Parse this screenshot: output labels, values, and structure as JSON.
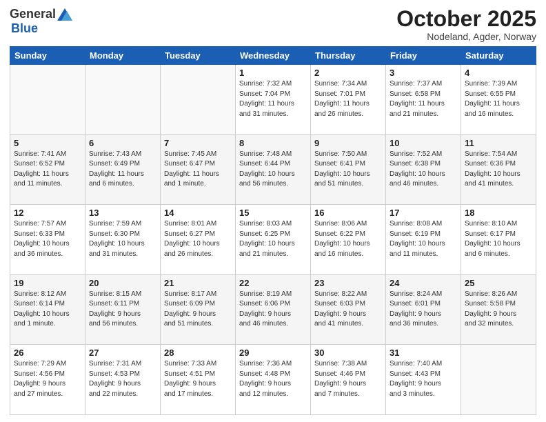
{
  "logo": {
    "general": "General",
    "blue": "Blue"
  },
  "header": {
    "month": "October 2025",
    "location": "Nodeland, Agder, Norway"
  },
  "weekdays": [
    "Sunday",
    "Monday",
    "Tuesday",
    "Wednesday",
    "Thursday",
    "Friday",
    "Saturday"
  ],
  "weeks": [
    [
      {
        "day": "",
        "info": ""
      },
      {
        "day": "",
        "info": ""
      },
      {
        "day": "",
        "info": ""
      },
      {
        "day": "1",
        "info": "Sunrise: 7:32 AM\nSunset: 7:04 PM\nDaylight: 11 hours\nand 31 minutes."
      },
      {
        "day": "2",
        "info": "Sunrise: 7:34 AM\nSunset: 7:01 PM\nDaylight: 11 hours\nand 26 minutes."
      },
      {
        "day": "3",
        "info": "Sunrise: 7:37 AM\nSunset: 6:58 PM\nDaylight: 11 hours\nand 21 minutes."
      },
      {
        "day": "4",
        "info": "Sunrise: 7:39 AM\nSunset: 6:55 PM\nDaylight: 11 hours\nand 16 minutes."
      }
    ],
    [
      {
        "day": "5",
        "info": "Sunrise: 7:41 AM\nSunset: 6:52 PM\nDaylight: 11 hours\nand 11 minutes."
      },
      {
        "day": "6",
        "info": "Sunrise: 7:43 AM\nSunset: 6:49 PM\nDaylight: 11 hours\nand 6 minutes."
      },
      {
        "day": "7",
        "info": "Sunrise: 7:45 AM\nSunset: 6:47 PM\nDaylight: 11 hours\nand 1 minute."
      },
      {
        "day": "8",
        "info": "Sunrise: 7:48 AM\nSunset: 6:44 PM\nDaylight: 10 hours\nand 56 minutes."
      },
      {
        "day": "9",
        "info": "Sunrise: 7:50 AM\nSunset: 6:41 PM\nDaylight: 10 hours\nand 51 minutes."
      },
      {
        "day": "10",
        "info": "Sunrise: 7:52 AM\nSunset: 6:38 PM\nDaylight: 10 hours\nand 46 minutes."
      },
      {
        "day": "11",
        "info": "Sunrise: 7:54 AM\nSunset: 6:36 PM\nDaylight: 10 hours\nand 41 minutes."
      }
    ],
    [
      {
        "day": "12",
        "info": "Sunrise: 7:57 AM\nSunset: 6:33 PM\nDaylight: 10 hours\nand 36 minutes."
      },
      {
        "day": "13",
        "info": "Sunrise: 7:59 AM\nSunset: 6:30 PM\nDaylight: 10 hours\nand 31 minutes."
      },
      {
        "day": "14",
        "info": "Sunrise: 8:01 AM\nSunset: 6:27 PM\nDaylight: 10 hours\nand 26 minutes."
      },
      {
        "day": "15",
        "info": "Sunrise: 8:03 AM\nSunset: 6:25 PM\nDaylight: 10 hours\nand 21 minutes."
      },
      {
        "day": "16",
        "info": "Sunrise: 8:06 AM\nSunset: 6:22 PM\nDaylight: 10 hours\nand 16 minutes."
      },
      {
        "day": "17",
        "info": "Sunrise: 8:08 AM\nSunset: 6:19 PM\nDaylight: 10 hours\nand 11 minutes."
      },
      {
        "day": "18",
        "info": "Sunrise: 8:10 AM\nSunset: 6:17 PM\nDaylight: 10 hours\nand 6 minutes."
      }
    ],
    [
      {
        "day": "19",
        "info": "Sunrise: 8:12 AM\nSunset: 6:14 PM\nDaylight: 10 hours\nand 1 minute."
      },
      {
        "day": "20",
        "info": "Sunrise: 8:15 AM\nSunset: 6:11 PM\nDaylight: 9 hours\nand 56 minutes."
      },
      {
        "day": "21",
        "info": "Sunrise: 8:17 AM\nSunset: 6:09 PM\nDaylight: 9 hours\nand 51 minutes."
      },
      {
        "day": "22",
        "info": "Sunrise: 8:19 AM\nSunset: 6:06 PM\nDaylight: 9 hours\nand 46 minutes."
      },
      {
        "day": "23",
        "info": "Sunrise: 8:22 AM\nSunset: 6:03 PM\nDaylight: 9 hours\nand 41 minutes."
      },
      {
        "day": "24",
        "info": "Sunrise: 8:24 AM\nSunset: 6:01 PM\nDaylight: 9 hours\nand 36 minutes."
      },
      {
        "day": "25",
        "info": "Sunrise: 8:26 AM\nSunset: 5:58 PM\nDaylight: 9 hours\nand 32 minutes."
      }
    ],
    [
      {
        "day": "26",
        "info": "Sunrise: 7:29 AM\nSunset: 4:56 PM\nDaylight: 9 hours\nand 27 minutes."
      },
      {
        "day": "27",
        "info": "Sunrise: 7:31 AM\nSunset: 4:53 PM\nDaylight: 9 hours\nand 22 minutes."
      },
      {
        "day": "28",
        "info": "Sunrise: 7:33 AM\nSunset: 4:51 PM\nDaylight: 9 hours\nand 17 minutes."
      },
      {
        "day": "29",
        "info": "Sunrise: 7:36 AM\nSunset: 4:48 PM\nDaylight: 9 hours\nand 12 minutes."
      },
      {
        "day": "30",
        "info": "Sunrise: 7:38 AM\nSunset: 4:46 PM\nDaylight: 9 hours\nand 7 minutes."
      },
      {
        "day": "31",
        "info": "Sunrise: 7:40 AM\nSunset: 4:43 PM\nDaylight: 9 hours\nand 3 minutes."
      },
      {
        "day": "",
        "info": ""
      }
    ]
  ]
}
